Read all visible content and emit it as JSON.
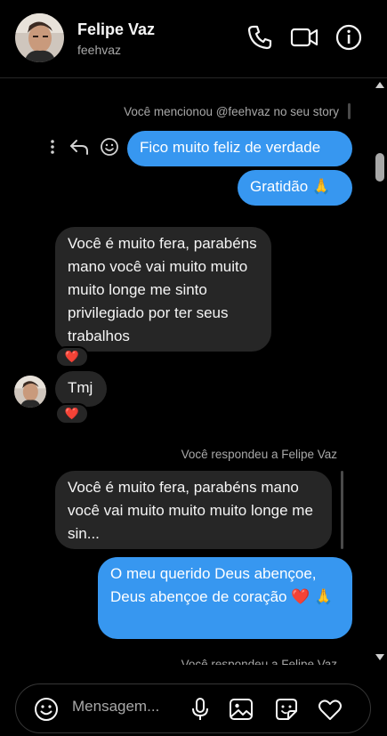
{
  "header": {
    "name": "Felipe Vaz",
    "handle": "feehvaz",
    "icons": [
      "phone-icon",
      "video-camera-icon",
      "info-icon"
    ]
  },
  "chat": {
    "story_notice": "Você mencionou @feehvaz no seu story",
    "outgoing_1": "Fico muito feliz de verdade",
    "outgoing_2": "Gratidão 🙏",
    "incoming_1": "Você é muito fera, parabéns mano você vai muito muito muito longe me sinto privilegiado por ter seus trabalhos",
    "reaction_1": "❤️",
    "incoming_2": "Tmj",
    "reaction_2": "❤️",
    "reply_notice_1": "Você respondeu a Felipe Vaz",
    "quoted_text": "Você é muito fera, parabéns mano você vai muito muito muito longe me sin...",
    "outgoing_3": "O meu querido Deus abençoe, Deus abençoe de coração ❤️ 🙏",
    "reply_notice_2": "Você respondeu a Felipe Vaz"
  },
  "composer": {
    "placeholder": "Mensagem..."
  },
  "colors": {
    "outgoing_bubble": "#3797f0",
    "incoming_bubble": "#262626",
    "background": "#000000"
  }
}
